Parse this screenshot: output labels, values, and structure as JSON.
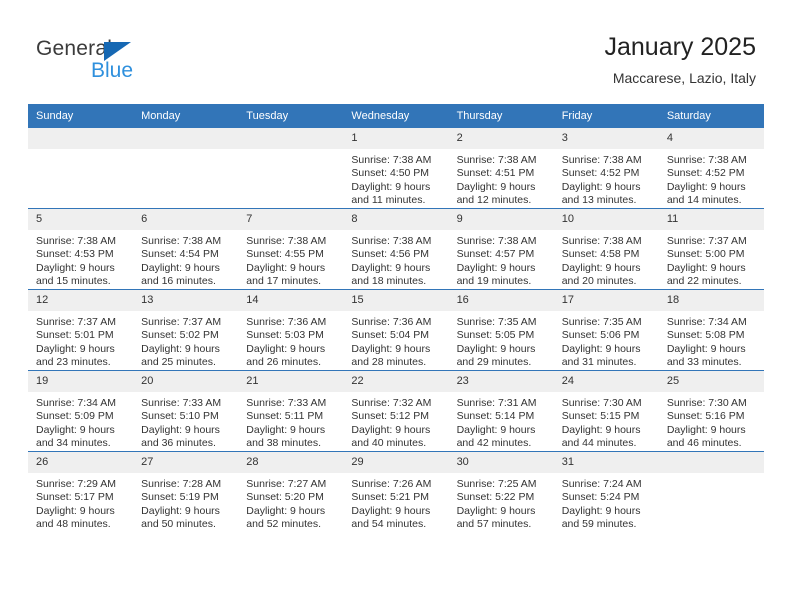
{
  "brand": {
    "name_top": "General",
    "name_bottom": "Blue",
    "triangle_color": "#1668b3",
    "blue_color": "#2f90dd"
  },
  "header": {
    "title": "January 2025",
    "subtitle": "Maccarese, Lazio, Italy"
  },
  "theme": {
    "header_blue": "#3275b8",
    "daynum_band": "#efefef",
    "text": "#333333"
  },
  "weekday_headers": [
    "Sunday",
    "Monday",
    "Tuesday",
    "Wednesday",
    "Thursday",
    "Friday",
    "Saturday"
  ],
  "weeks": [
    [
      {
        "day": "",
        "lines": []
      },
      {
        "day": "",
        "lines": []
      },
      {
        "day": "",
        "lines": []
      },
      {
        "day": "1",
        "lines": [
          "Sunrise: 7:38 AM",
          "Sunset: 4:50 PM",
          "Daylight: 9 hours",
          "and 11 minutes."
        ]
      },
      {
        "day": "2",
        "lines": [
          "Sunrise: 7:38 AM",
          "Sunset: 4:51 PM",
          "Daylight: 9 hours",
          "and 12 minutes."
        ]
      },
      {
        "day": "3",
        "lines": [
          "Sunrise: 7:38 AM",
          "Sunset: 4:52 PM",
          "Daylight: 9 hours",
          "and 13 minutes."
        ]
      },
      {
        "day": "4",
        "lines": [
          "Sunrise: 7:38 AM",
          "Sunset: 4:52 PM",
          "Daylight: 9 hours",
          "and 14 minutes."
        ]
      }
    ],
    [
      {
        "day": "5",
        "lines": [
          "Sunrise: 7:38 AM",
          "Sunset: 4:53 PM",
          "Daylight: 9 hours",
          "and 15 minutes."
        ]
      },
      {
        "day": "6",
        "lines": [
          "Sunrise: 7:38 AM",
          "Sunset: 4:54 PM",
          "Daylight: 9 hours",
          "and 16 minutes."
        ]
      },
      {
        "day": "7",
        "lines": [
          "Sunrise: 7:38 AM",
          "Sunset: 4:55 PM",
          "Daylight: 9 hours",
          "and 17 minutes."
        ]
      },
      {
        "day": "8",
        "lines": [
          "Sunrise: 7:38 AM",
          "Sunset: 4:56 PM",
          "Daylight: 9 hours",
          "and 18 minutes."
        ]
      },
      {
        "day": "9",
        "lines": [
          "Sunrise: 7:38 AM",
          "Sunset: 4:57 PM",
          "Daylight: 9 hours",
          "and 19 minutes."
        ]
      },
      {
        "day": "10",
        "lines": [
          "Sunrise: 7:38 AM",
          "Sunset: 4:58 PM",
          "Daylight: 9 hours",
          "and 20 minutes."
        ]
      },
      {
        "day": "11",
        "lines": [
          "Sunrise: 7:37 AM",
          "Sunset: 5:00 PM",
          "Daylight: 9 hours",
          "and 22 minutes."
        ]
      }
    ],
    [
      {
        "day": "12",
        "lines": [
          "Sunrise: 7:37 AM",
          "Sunset: 5:01 PM",
          "Daylight: 9 hours",
          "and 23 minutes."
        ]
      },
      {
        "day": "13",
        "lines": [
          "Sunrise: 7:37 AM",
          "Sunset: 5:02 PM",
          "Daylight: 9 hours",
          "and 25 minutes."
        ]
      },
      {
        "day": "14",
        "lines": [
          "Sunrise: 7:36 AM",
          "Sunset: 5:03 PM",
          "Daylight: 9 hours",
          "and 26 minutes."
        ]
      },
      {
        "day": "15",
        "lines": [
          "Sunrise: 7:36 AM",
          "Sunset: 5:04 PM",
          "Daylight: 9 hours",
          "and 28 minutes."
        ]
      },
      {
        "day": "16",
        "lines": [
          "Sunrise: 7:35 AM",
          "Sunset: 5:05 PM",
          "Daylight: 9 hours",
          "and 29 minutes."
        ]
      },
      {
        "day": "17",
        "lines": [
          "Sunrise: 7:35 AM",
          "Sunset: 5:06 PM",
          "Daylight: 9 hours",
          "and 31 minutes."
        ]
      },
      {
        "day": "18",
        "lines": [
          "Sunrise: 7:34 AM",
          "Sunset: 5:08 PM",
          "Daylight: 9 hours",
          "and 33 minutes."
        ]
      }
    ],
    [
      {
        "day": "19",
        "lines": [
          "Sunrise: 7:34 AM",
          "Sunset: 5:09 PM",
          "Daylight: 9 hours",
          "and 34 minutes."
        ]
      },
      {
        "day": "20",
        "lines": [
          "Sunrise: 7:33 AM",
          "Sunset: 5:10 PM",
          "Daylight: 9 hours",
          "and 36 minutes."
        ]
      },
      {
        "day": "21",
        "lines": [
          "Sunrise: 7:33 AM",
          "Sunset: 5:11 PM",
          "Daylight: 9 hours",
          "and 38 minutes."
        ]
      },
      {
        "day": "22",
        "lines": [
          "Sunrise: 7:32 AM",
          "Sunset: 5:12 PM",
          "Daylight: 9 hours",
          "and 40 minutes."
        ]
      },
      {
        "day": "23",
        "lines": [
          "Sunrise: 7:31 AM",
          "Sunset: 5:14 PM",
          "Daylight: 9 hours",
          "and 42 minutes."
        ]
      },
      {
        "day": "24",
        "lines": [
          "Sunrise: 7:30 AM",
          "Sunset: 5:15 PM",
          "Daylight: 9 hours",
          "and 44 minutes."
        ]
      },
      {
        "day": "25",
        "lines": [
          "Sunrise: 7:30 AM",
          "Sunset: 5:16 PM",
          "Daylight: 9 hours",
          "and 46 minutes."
        ]
      }
    ],
    [
      {
        "day": "26",
        "lines": [
          "Sunrise: 7:29 AM",
          "Sunset: 5:17 PM",
          "Daylight: 9 hours",
          "and 48 minutes."
        ]
      },
      {
        "day": "27",
        "lines": [
          "Sunrise: 7:28 AM",
          "Sunset: 5:19 PM",
          "Daylight: 9 hours",
          "and 50 minutes."
        ]
      },
      {
        "day": "28",
        "lines": [
          "Sunrise: 7:27 AM",
          "Sunset: 5:20 PM",
          "Daylight: 9 hours",
          "and 52 minutes."
        ]
      },
      {
        "day": "29",
        "lines": [
          "Sunrise: 7:26 AM",
          "Sunset: 5:21 PM",
          "Daylight: 9 hours",
          "and 54 minutes."
        ]
      },
      {
        "day": "30",
        "lines": [
          "Sunrise: 7:25 AM",
          "Sunset: 5:22 PM",
          "Daylight: 9 hours",
          "and 57 minutes."
        ]
      },
      {
        "day": "31",
        "lines": [
          "Sunrise: 7:24 AM",
          "Sunset: 5:24 PM",
          "Daylight: 9 hours",
          "and 59 minutes."
        ]
      },
      {
        "day": "",
        "lines": []
      }
    ]
  ]
}
